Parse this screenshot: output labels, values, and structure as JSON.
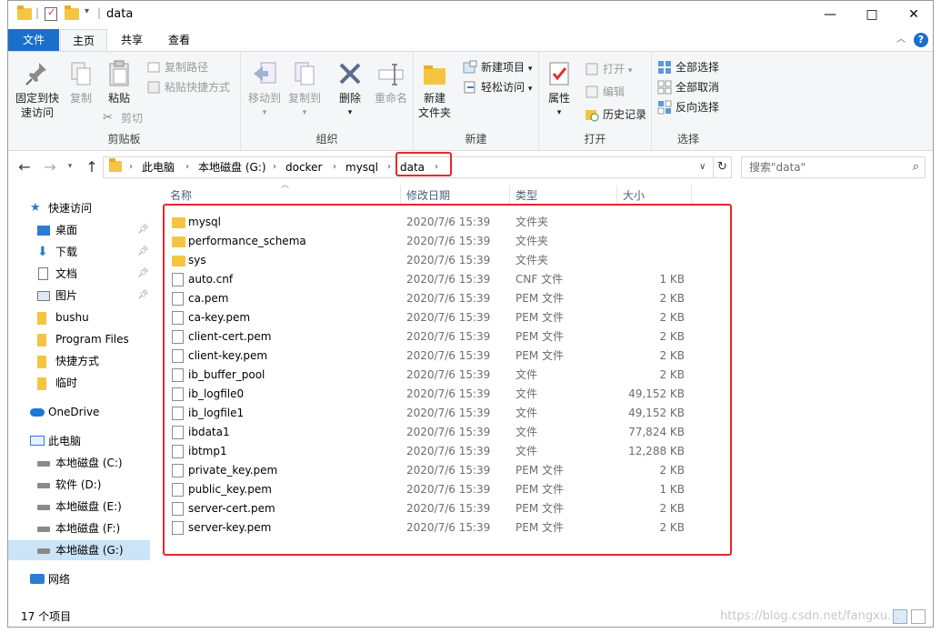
{
  "window": {
    "title": "data",
    "quick_access_separator": "="
  },
  "ribbon_tabs": [
    {
      "label": "文件",
      "id": "file"
    },
    {
      "label": "主页",
      "id": "home"
    },
    {
      "label": "共享",
      "id": "share"
    },
    {
      "label": "查看",
      "id": "view"
    }
  ],
  "ribbon": {
    "clipboard": {
      "label": "剪贴板",
      "pin_line1": "固定到快",
      "pin_line2": "速访问",
      "copy": "复制",
      "paste": "粘贴",
      "copy_path": "复制路径",
      "paste_shortcut": "粘贴快捷方式",
      "cut": "剪切"
    },
    "organize": {
      "label": "组织",
      "move_to": "移动到",
      "copy_to": "复制到",
      "delete": "删除",
      "rename": "重命名"
    },
    "new": {
      "label": "新建",
      "new_folder_line1": "新建",
      "new_folder_line2": "文件夹",
      "new_item": "新建项目",
      "easy_access": "轻松访问"
    },
    "open": {
      "label": "打开",
      "properties": "属性",
      "open": "打开",
      "edit": "编辑",
      "history": "历史记录"
    },
    "select": {
      "label": "选择",
      "select_all": "全部选择",
      "select_none": "全部取消",
      "invert": "反向选择"
    }
  },
  "address": {
    "crumbs": [
      "此电脑",
      "本地磁盘 (G:)",
      "docker",
      "mysql",
      "data"
    ],
    "search_placeholder": "搜索\"data\""
  },
  "nav": {
    "quick_access": "快速访问",
    "items": [
      {
        "label": "桌面",
        "pinned": true
      },
      {
        "label": "下载",
        "pinned": true
      },
      {
        "label": "文档",
        "pinned": true
      },
      {
        "label": "图片",
        "pinned": true
      },
      {
        "label": "bushu",
        "pinned": false
      },
      {
        "label": "Program Files",
        "pinned": false
      },
      {
        "label": "快捷方式",
        "pinned": false
      },
      {
        "label": "临时",
        "pinned": false
      }
    ],
    "onedrive": "OneDrive",
    "this_pc": "此电脑",
    "drives": [
      "本地磁盘 (C:)",
      "软件 (D:)",
      "本地磁盘 (E:)",
      "本地磁盘 (F:)",
      "本地磁盘 (G:)"
    ],
    "network": "网络"
  },
  "columns": {
    "name": "名称",
    "date": "修改日期",
    "type": "类型",
    "size": "大小"
  },
  "files": [
    {
      "name": "mysql",
      "date": "2020/7/6 15:39",
      "type": "文件夹",
      "size": "",
      "kind": "folder"
    },
    {
      "name": "performance_schema",
      "date": "2020/7/6 15:39",
      "type": "文件夹",
      "size": "",
      "kind": "folder"
    },
    {
      "name": "sys",
      "date": "2020/7/6 15:39",
      "type": "文件夹",
      "size": "",
      "kind": "folder"
    },
    {
      "name": "auto.cnf",
      "date": "2020/7/6 15:39",
      "type": "CNF 文件",
      "size": "1 KB",
      "kind": "file"
    },
    {
      "name": "ca.pem",
      "date": "2020/7/6 15:39",
      "type": "PEM 文件",
      "size": "2 KB",
      "kind": "file"
    },
    {
      "name": "ca-key.pem",
      "date": "2020/7/6 15:39",
      "type": "PEM 文件",
      "size": "2 KB",
      "kind": "file"
    },
    {
      "name": "client-cert.pem",
      "date": "2020/7/6 15:39",
      "type": "PEM 文件",
      "size": "2 KB",
      "kind": "file"
    },
    {
      "name": "client-key.pem",
      "date": "2020/7/6 15:39",
      "type": "PEM 文件",
      "size": "2 KB",
      "kind": "file"
    },
    {
      "name": "ib_buffer_pool",
      "date": "2020/7/6 15:39",
      "type": "文件",
      "size": "2 KB",
      "kind": "file"
    },
    {
      "name": "ib_logfile0",
      "date": "2020/7/6 15:39",
      "type": "文件",
      "size": "49,152 KB",
      "kind": "file"
    },
    {
      "name": "ib_logfile1",
      "date": "2020/7/6 15:39",
      "type": "文件",
      "size": "49,152 KB",
      "kind": "file"
    },
    {
      "name": "ibdata1",
      "date": "2020/7/6 15:39",
      "type": "文件",
      "size": "77,824 KB",
      "kind": "file"
    },
    {
      "name": "ibtmp1",
      "date": "2020/7/6 15:39",
      "type": "文件",
      "size": "12,288 KB",
      "kind": "file"
    },
    {
      "name": "private_key.pem",
      "date": "2020/7/6 15:39",
      "type": "PEM 文件",
      "size": "2 KB",
      "kind": "file"
    },
    {
      "name": "public_key.pem",
      "date": "2020/7/6 15:39",
      "type": "PEM 文件",
      "size": "1 KB",
      "kind": "file"
    },
    {
      "name": "server-cert.pem",
      "date": "2020/7/6 15:39",
      "type": "PEM 文件",
      "size": "2 KB",
      "kind": "file"
    },
    {
      "name": "server-key.pem",
      "date": "2020/7/6 15:39",
      "type": "PEM 文件",
      "size": "2 KB",
      "kind": "file"
    }
  ],
  "status": {
    "item_count": "17 个项目"
  },
  "watermark": "https://blog.csdn.net/fangxu...",
  "colors": {
    "accent": "#1a6fc9",
    "highlight": "#e8262d",
    "folder": "#f5c542",
    "selected": "#cce4f7"
  }
}
